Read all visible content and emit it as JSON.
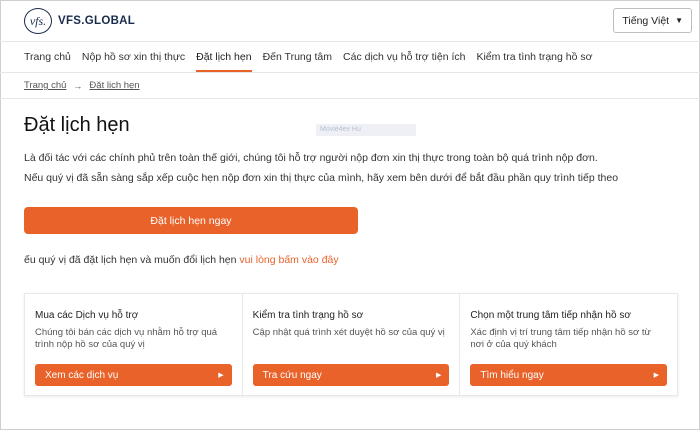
{
  "header": {
    "logo_mark": "vfs.",
    "logo_text": "VFS.GLOBAL",
    "language": "Tiếng Việt"
  },
  "nav": {
    "items": [
      {
        "label": "Trang chủ"
      },
      {
        "label": "Nộp hồ sơ xin thị thực"
      },
      {
        "label": "Đặt lịch hẹn"
      },
      {
        "label": "Đến Trung tâm"
      },
      {
        "label": "Các dịch vụ hỗ trợ tiện ích"
      },
      {
        "label": "Kiểm tra tình trạng hồ sơ"
      }
    ],
    "active_index": 2
  },
  "breadcrumb": {
    "home": "Trang chủ",
    "current": "Đặt lịch hẹn"
  },
  "main": {
    "title": "Đặt lịch hẹn",
    "ghost_text": "Movie4ev Hu",
    "paragraph1": "Là đối tác với các chính phủ trên toàn thế giới, chúng tôi hỗ trợ người nộp đơn xin thị thực trong toàn bộ quá trình nộp đơn.",
    "paragraph2": "Nếu quý vị đã sẵn sàng sắp xếp cuộc hẹn nộp đơn xin thị thực của mình, hãy xem bên dưới để bắt đầu phần quy trình tiếp theo",
    "book_button": "Đặt lịch hẹn ngay",
    "reschedule_text": "ếu quý vị đã đặt lịch hẹn và muốn đổi lịch hẹn ",
    "reschedule_link": "vui lòng bấm vào đây"
  },
  "cards": [
    {
      "title": "Mua các Dịch vụ hỗ trợ",
      "desc": "Chúng tôi bán các dịch vụ nhằm hỗ trợ quá trình nộp hồ sơ của quý vị",
      "button": "Xem các dịch vụ"
    },
    {
      "title": "Kiểm tra tình trạng hồ sơ",
      "desc": "Cập nhật quá trình xét duyệt hồ sơ của quý vị",
      "button": "Tra cứu ngay"
    },
    {
      "title": "Chọn một trung tâm tiếp nhận hồ sơ",
      "desc": "Xác định vị trí trung tâm tiếp nhận hồ sơ từ nơi ở của quý khách",
      "button": "Tìm hiểu ngay"
    }
  ],
  "colors": {
    "accent": "#e8622a",
    "brand": "#1a2b4c"
  }
}
